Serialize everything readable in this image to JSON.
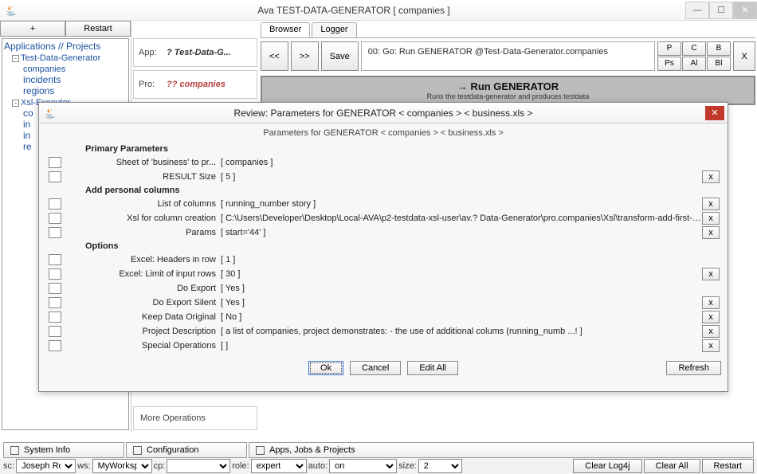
{
  "window": {
    "title": "Ava TEST-DATA-GENERATOR [ companies ]"
  },
  "leftcol": {
    "add": "+",
    "restart": "Restart",
    "tree": {
      "title": "Applications // Projects",
      "nodes": [
        {
          "label": "Test-Data-Generator",
          "children": [
            "companies",
            "incidents",
            "regions"
          ]
        },
        {
          "label": "Xsl-Executor",
          "children": [
            "co",
            "in",
            "in",
            "re"
          ]
        }
      ]
    }
  },
  "midcol": {
    "app_lbl": "App:",
    "app_val": "? Test-Data-G...",
    "pro_lbl": "Pro:",
    "pro_val": "?? companies",
    "moreops": "More Operations"
  },
  "right": {
    "tabs": [
      "Browser",
      "Logger"
    ],
    "nav": {
      "back": "<<",
      "fwd": ">>",
      "save": "Save"
    },
    "runtext": "00: Go: Run GENERATOR @Test-Data-Generator.companies",
    "letters": [
      "P",
      "C",
      "B",
      "Ps",
      "Al",
      "Bl"
    ],
    "x": "X",
    "runbar": {
      "title": "→ Run GENERATOR",
      "sub": "Runs the testdata-generator and produces testdata"
    }
  },
  "modal": {
    "title": "Review: Parameters for GENERATOR  < companies >  < business.xls >",
    "subhead": "Parameters for GENERATOR  < companies >  < business.xls >",
    "sections": {
      "primary": "Primary Parameters",
      "addcol": "Add personal columns",
      "options": "Options"
    },
    "params": [
      {
        "label": "Sheet of 'business' to pr...",
        "val": "[ companies ]",
        "x": false
      },
      {
        "label": "RESULT Size",
        "val": "[ 5 ]",
        "x": true
      },
      {
        "label": "List of columns",
        "val": "[ running_number story ]",
        "x": true
      },
      {
        "label": "Xsl for column creation",
        "val": "[ C:\\Users\\Developer\\Desktop\\Local-AVA\\p2-testdata-xsl-user\\av.? Data-Generator\\pro.companies\\Xsl\\transform-add-first-s-t.xsl ]",
        "x": true
      },
      {
        "label": "Params",
        "val": "[ start='44' ]",
        "x": true
      },
      {
        "label": "Excel: Headers in row",
        "val": "[ 1 ]",
        "x": false
      },
      {
        "label": "Excel: Limit of input rows",
        "val": "[ 30 ]",
        "x": true
      },
      {
        "label": "Do Export",
        "val": "[ Yes ]",
        "x": false
      },
      {
        "label": "Do Export Silent",
        "val": "[ Yes ]",
        "x": true
      },
      {
        "label": "Keep Data Original",
        "val": "[ No ]",
        "x": true
      },
      {
        "label": "Project Description",
        "val": "[ a list of companies, project demonstrates: - the use of additional colums (running_numb ...! ]",
        "x": true
      },
      {
        "label": "Special Operations",
        "val": "[  ]",
        "x": true
      }
    ],
    "footer": {
      "ok": "Ok",
      "cancel": "Cancel",
      "editall": "Edit All",
      "refresh": "Refresh"
    }
  },
  "statusbar": {
    "sysinfo": "System Info",
    "config": "Configuration",
    "apps": "Apps, Jobs & Projects"
  },
  "combobar": {
    "sc_lbl": "sc:",
    "sc_val": "Joseph Roth",
    "ws_lbl": "ws:",
    "ws_val": "MyWorkspace",
    "cp_lbl": "cp:",
    "cp_val": "",
    "role_lbl": "role:",
    "role_val": "expert",
    "auto_lbl": "auto:",
    "auto_val": "on",
    "size_lbl": "size:",
    "size_val": "2",
    "clearlog": "Clear Log4j",
    "clearall": "Clear All",
    "restart": "Restart"
  }
}
